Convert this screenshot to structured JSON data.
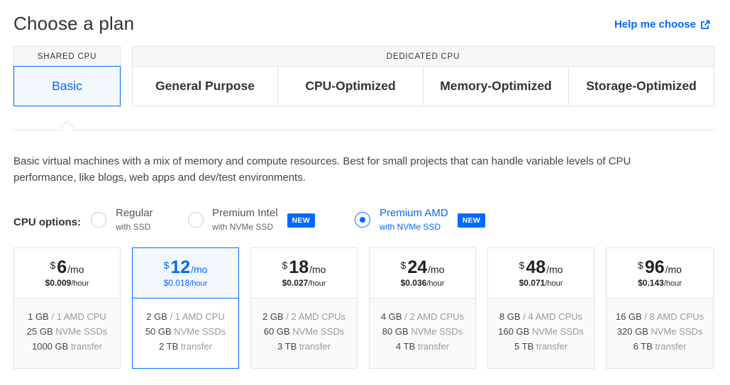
{
  "page": {
    "title": "Choose a plan",
    "help_link": "Help me choose"
  },
  "groups": {
    "shared": "SHARED CPU",
    "dedicated": "DEDICATED CPU"
  },
  "tabs": [
    {
      "label": "Basic",
      "selected": true
    },
    {
      "label": "General Purpose"
    },
    {
      "label": "CPU-Optimized"
    },
    {
      "label": "Memory-Optimized"
    },
    {
      "label": "Storage-Optimized"
    }
  ],
  "description": "Basic virtual machines with a mix of memory and compute resources. Best for small projects that can handle variable levels of CPU performance, like blogs, web apps and dev/test environments.",
  "cpu_options": {
    "label": "CPU options:",
    "options": [
      {
        "title": "Regular",
        "sub": "with SSD",
        "checked": false
      },
      {
        "title": "Premium Intel",
        "sub": "with NVMe SSD",
        "badge": "NEW",
        "checked": false
      },
      {
        "title": "Premium AMD",
        "sub": "with NVMe SSD",
        "badge": "NEW",
        "checked": true
      }
    ]
  },
  "plans": [
    {
      "dollar": "$",
      "amount": "6",
      "per": "/mo",
      "hourly": "$0.009",
      "hunit": "/hour",
      "mem": "1 GB",
      "cpu": "/ 1 AMD CPU",
      "disk": "25 GB",
      "disk_unit": "NVMe SSDs",
      "transfer": "1000 GB",
      "transfer_unit": "transfer",
      "selected": false
    },
    {
      "dollar": "$",
      "amount": "12",
      "per": "/mo",
      "hourly": "$0.018",
      "hunit": "/hour",
      "mem": "2 GB",
      "cpu": "/ 1 AMD CPU",
      "disk": "50 GB",
      "disk_unit": "NVMe SSDs",
      "transfer": "2 TB",
      "transfer_unit": "transfer",
      "selected": true
    },
    {
      "dollar": "$",
      "amount": "18",
      "per": "/mo",
      "hourly": "$0.027",
      "hunit": "/hour",
      "mem": "2 GB",
      "cpu": "/ 2 AMD CPUs",
      "disk": "60 GB",
      "disk_unit": "NVMe SSDs",
      "transfer": "3 TB",
      "transfer_unit": "transfer",
      "selected": false
    },
    {
      "dollar": "$",
      "amount": "24",
      "per": "/mo",
      "hourly": "$0.036",
      "hunit": "/hour",
      "mem": "4 GB",
      "cpu": "/ 2 AMD CPUs",
      "disk": "80 GB",
      "disk_unit": "NVMe SSDs",
      "transfer": "4 TB",
      "transfer_unit": "transfer",
      "selected": false
    },
    {
      "dollar": "$",
      "amount": "48",
      "per": "/mo",
      "hourly": "$0.071",
      "hunit": "/hour",
      "mem": "8 GB",
      "cpu": "/ 4 AMD CPUs",
      "disk": "160 GB",
      "disk_unit": "NVMe SSDs",
      "transfer": "5 TB",
      "transfer_unit": "transfer",
      "selected": false
    },
    {
      "dollar": "$",
      "amount": "96",
      "per": "/mo",
      "hourly": "$0.143",
      "hunit": "/hour",
      "mem": "16 GB",
      "cpu": "/ 8 AMD CPUs",
      "disk": "320 GB",
      "disk_unit": "NVMe SSDs",
      "transfer": "6 TB",
      "transfer_unit": "transfer",
      "selected": false
    }
  ],
  "colors": {
    "accent": "#0069ff",
    "border": "#dfe2e7"
  },
  "icons": {
    "help": "external-link-icon"
  }
}
